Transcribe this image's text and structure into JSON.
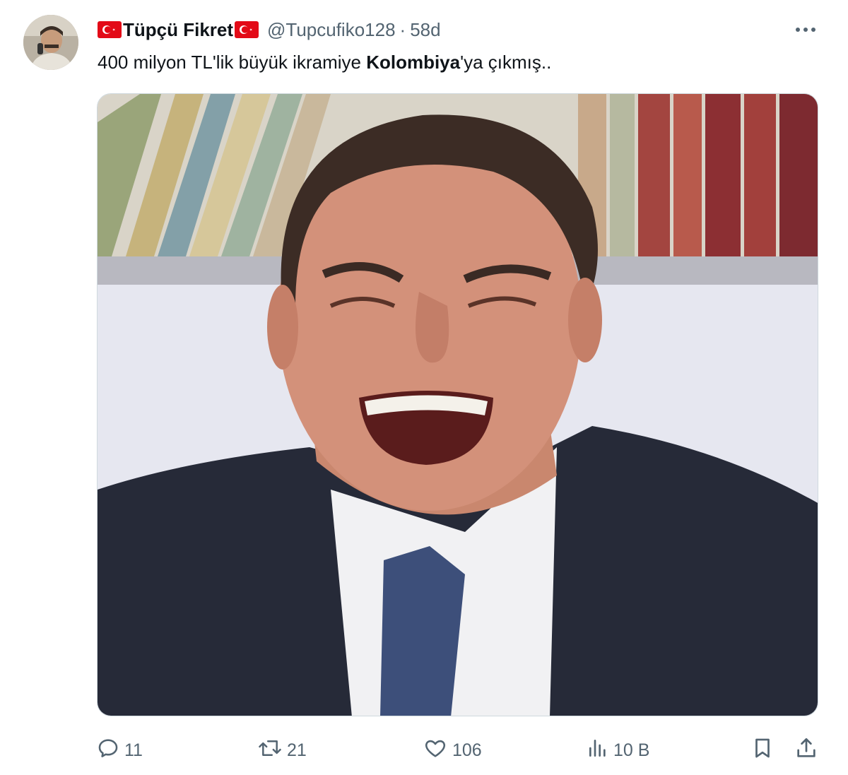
{
  "tweet": {
    "author_name": "Tüpçü Fikret",
    "handle": "@Tupcufiko128",
    "separator": "·",
    "time": "58d",
    "text_before": "400 milyon TL'lik büyük ikramiye ",
    "text_bold": "Kolombiya",
    "text_after": "'ya çıkmış.."
  },
  "actions": {
    "replies": "11",
    "reposts": "21",
    "likes": "106",
    "views": "10 B"
  },
  "icons": {
    "more": "more-icon",
    "reply": "reply-icon",
    "repost": "repost-icon",
    "like": "heart-icon",
    "views": "views-icon",
    "bookmark": "bookmark-icon",
    "share": "share-icon",
    "flag": "turkey-flag-icon"
  },
  "colors": {
    "text": "#0f1419",
    "secondary": "#536471",
    "flag_red": "#e30a17"
  }
}
